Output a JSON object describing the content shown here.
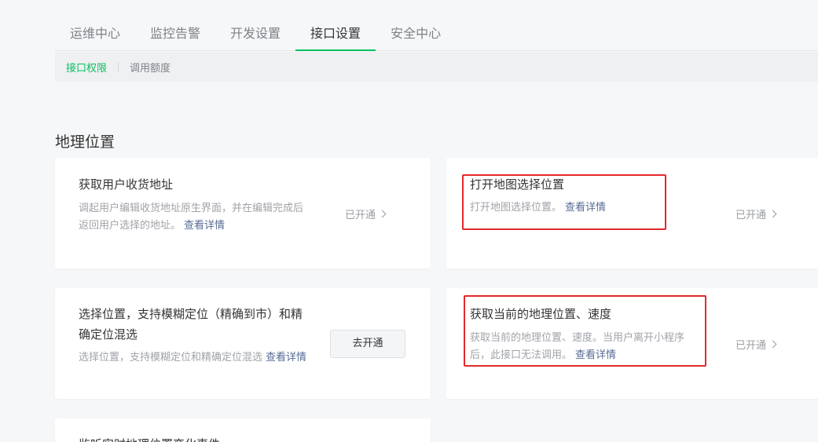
{
  "main_tabs": [
    {
      "label": "运维中心"
    },
    {
      "label": "监控告警"
    },
    {
      "label": "开发设置"
    },
    {
      "label": "接口设置",
      "active": true
    },
    {
      "label": "安全中心"
    }
  ],
  "sub_tabs": [
    {
      "label": "接口权限",
      "active": true
    },
    {
      "label": "调用额度"
    }
  ],
  "section_title": "地理位置",
  "detail_link": "查看详情",
  "cards": [
    {
      "title": "获取用户收货地址",
      "desc": "调起用户编辑收货地址原生界面，并在编辑完成后返回用户选择的地址。",
      "status": "已开通"
    },
    {
      "title": "打开地图选择位置",
      "desc": "打开地图选择位置。",
      "status": "已开通"
    },
    {
      "title": "选择位置，支持模糊定位（精确到市）和精确定位混选",
      "desc": "选择位置，支持模糊定位和精确定位混选",
      "button": "去开通"
    },
    {
      "title": "获取当前的地理位置、速度",
      "desc": "获取当前的地理位置、速度。当用户离开小程序后，此接口无法调用。",
      "status": "已开通"
    },
    {
      "title": "监听实时地理位置变化事件"
    }
  ],
  "colors": {
    "accent": "#07c160",
    "link": "#576b95",
    "highlight": "#e32a2a"
  }
}
